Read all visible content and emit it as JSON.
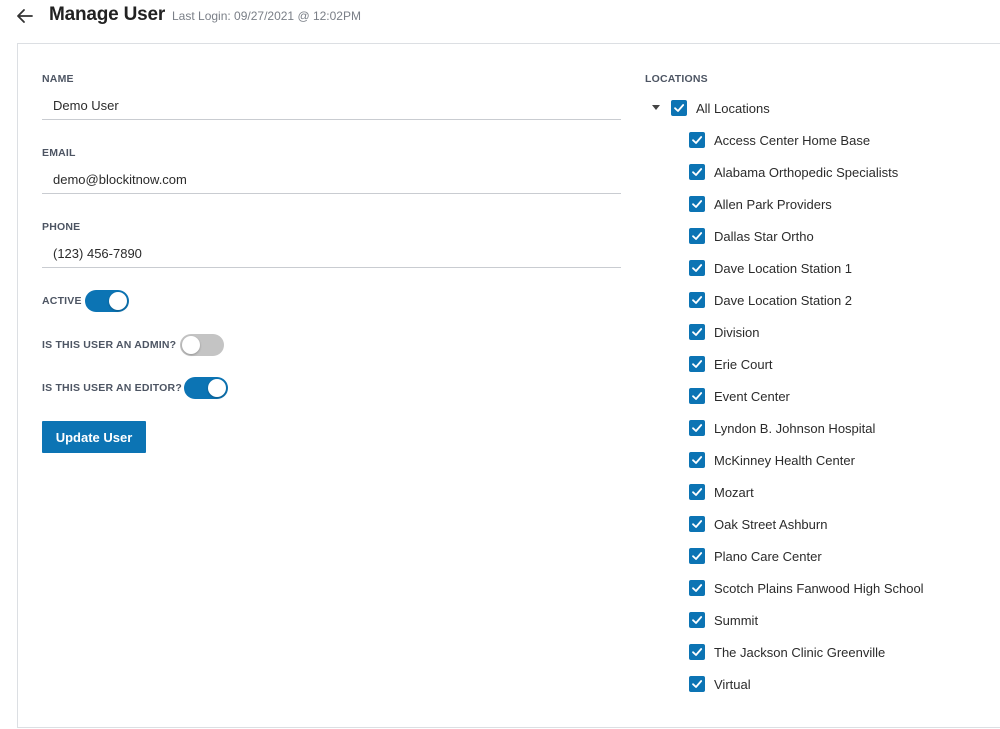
{
  "header": {
    "title": "Manage User",
    "last_login": "Last Login: 09/27/2021 @ 12:02PM"
  },
  "form": {
    "name": {
      "label": "NAME",
      "value": "Demo User"
    },
    "email": {
      "label": "EMAIL",
      "value": "demo@blockitnow.com"
    },
    "phone": {
      "label": "PHONE",
      "value": "(123) 456-7890"
    },
    "active": {
      "label": "ACTIVE",
      "on": true
    },
    "admin": {
      "label": "IS THIS USER AN ADMIN?",
      "on": false
    },
    "editor": {
      "label": "IS THIS USER AN EDITOR?",
      "on": true
    },
    "submit_label": "Update User"
  },
  "locations": {
    "title": "LOCATIONS",
    "all_label": "All Locations",
    "all_checked": true,
    "items": [
      {
        "label": "Access Center Home Base",
        "checked": true
      },
      {
        "label": "Alabama Orthopedic Specialists",
        "checked": true
      },
      {
        "label": "Allen Park Providers",
        "checked": true
      },
      {
        "label": "Dallas Star Ortho",
        "checked": true
      },
      {
        "label": "Dave Location Station 1",
        "checked": true
      },
      {
        "label": "Dave Location Station 2",
        "checked": true
      },
      {
        "label": "Division",
        "checked": true
      },
      {
        "label": "Erie Court",
        "checked": true
      },
      {
        "label": "Event Center",
        "checked": true
      },
      {
        "label": "Lyndon B. Johnson Hospital",
        "checked": true
      },
      {
        "label": "McKinney Health Center",
        "checked": true
      },
      {
        "label": "Mozart",
        "checked": true
      },
      {
        "label": "Oak Street Ashburn",
        "checked": true
      },
      {
        "label": "Plano Care Center",
        "checked": true
      },
      {
        "label": "Scotch Plains Fanwood High School",
        "checked": true
      },
      {
        "label": "Summit",
        "checked": true
      },
      {
        "label": "The Jackson Clinic Greenville",
        "checked": true
      },
      {
        "label": "Virtual",
        "checked": true
      }
    ]
  },
  "colors": {
    "accent": "#0c74b4",
    "toggle_off": "#c4c4c4",
    "border": "#dcdfe3"
  }
}
